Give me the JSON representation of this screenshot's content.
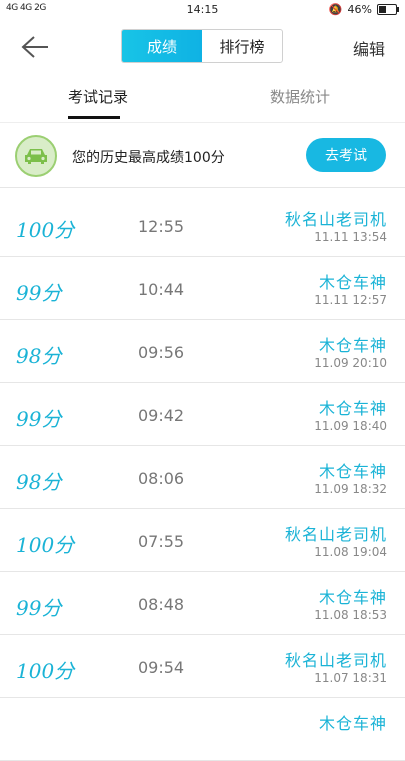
{
  "status": {
    "network": "4G 4G 2G",
    "time": "14:15",
    "battery": "46%",
    "battery_level": 0.46
  },
  "nav": {
    "tabs": [
      "成绩",
      "排行榜"
    ],
    "active_tab": 0,
    "edit_label": "编辑"
  },
  "subtabs": [
    "考试记录",
    "数据统计"
  ],
  "banner": {
    "text": "您的历史最高成绩100分",
    "button": "去考试"
  },
  "records": [
    {
      "score": "100分",
      "duration": "12:55",
      "name": "秋名山老司机",
      "date": "11.11  13:54"
    },
    {
      "score": "99分",
      "duration": "10:44",
      "name": "木仓车神",
      "date": "11.11  12:57"
    },
    {
      "score": "98分",
      "duration": "09:56",
      "name": "木仓车神",
      "date": "11.09  20:10"
    },
    {
      "score": "99分",
      "duration": "09:42",
      "name": "木仓车神",
      "date": "11.09  18:40"
    },
    {
      "score": "98分",
      "duration": "08:06",
      "name": "木仓车神",
      "date": "11.09  18:32"
    },
    {
      "score": "100分",
      "duration": "07:55",
      "name": "秋名山老司机",
      "date": "11.08  19:04"
    },
    {
      "score": "99分",
      "duration": "08:48",
      "name": "木仓车神",
      "date": "11.08  18:53"
    },
    {
      "score": "100分",
      "duration": "09:54",
      "name": "秋名山老司机",
      "date": "11.07  18:31"
    },
    {
      "score": "",
      "duration": "",
      "name": "木仓车神",
      "date": ""
    }
  ],
  "colors": {
    "accent": "#18b8e2",
    "score": "#1ab3d6",
    "badge_bg": "#d9edc8"
  }
}
